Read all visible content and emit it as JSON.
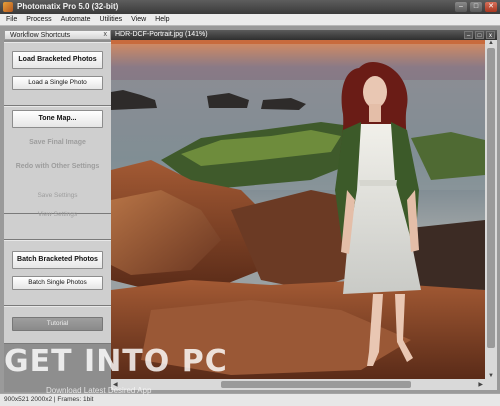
{
  "app": {
    "title": "Photomatix Pro 5.0 (32-bit)",
    "icon": "photomatix-icon"
  },
  "window_buttons": {
    "minimize": "–",
    "maximize": "□",
    "close": "✕"
  },
  "menu": [
    "File",
    "Process",
    "Automate",
    "Utilities",
    "View",
    "Help"
  ],
  "panel": {
    "title": "Workflow Shortcuts",
    "close": "x",
    "buttons": {
      "load_bracketed": "Load Bracketed Photos",
      "load_single": "Load a Single Photo",
      "tone_map": "Tone Map...",
      "save_final": "Save Final Image",
      "redo": "Redo with Other Settings",
      "save_settings": "Save Settings",
      "view_settings": "View Settings",
      "batch_bracketed": "Batch Bracketed Photos",
      "batch_single": "Batch Single Photos",
      "tutorial": "Tutorial"
    }
  },
  "image_window": {
    "title": "HDR-DCF-Portrait.jpg (141%)",
    "buttons": {
      "minimize": "–",
      "maximize": "□",
      "close": "x"
    }
  },
  "status": {
    "text": "900x521 2000x2 | Frames: 1bit"
  },
  "watermark": {
    "main": "GET INTO PC",
    "sub": "Download Latest Desired App"
  }
}
